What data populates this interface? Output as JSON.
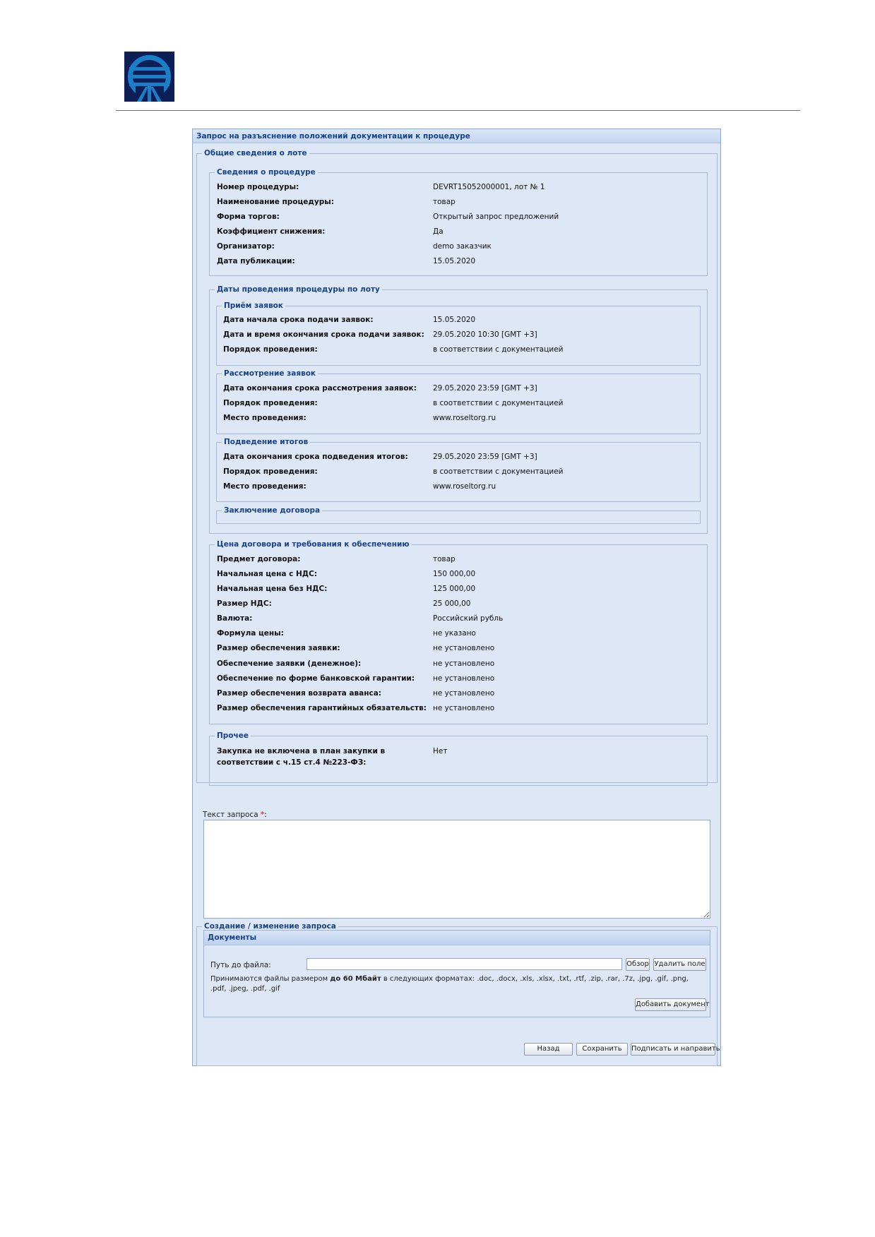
{
  "window": {
    "title": "Запрос на разъяснение положений документации к процедуре"
  },
  "general": {
    "legend": "Общие сведения о лоте",
    "procedure": {
      "legend": "Сведения о процедуре",
      "rows": [
        {
          "label": "Номер процедуры:",
          "value": "DEVRT15052000001, лот № 1"
        },
        {
          "label": "Наименование процедуры:",
          "value": "товар"
        },
        {
          "label": "Форма торгов:",
          "value": "Открытый запрос предложений"
        },
        {
          "label": "Коэффициент снижения:",
          "value": "Да"
        },
        {
          "label": "Организатор:",
          "value": "demo заказчик"
        },
        {
          "label": "Дата публикации:",
          "value": "15.05.2020"
        }
      ]
    },
    "dates": {
      "legend": "Даты проведения процедуры по лоту",
      "receipt": {
        "legend": "Приём заявок",
        "rows": [
          {
            "label": "Дата начала срока подачи заявок:",
            "value": "15.05.2020"
          },
          {
            "label": "Дата и время окончания срока подачи заявок:",
            "value": "29.05.2020 10:30 [GMT +3]"
          },
          {
            "label": "Порядок проведения:",
            "value": "в соответствии с документацией"
          }
        ]
      },
      "review": {
        "legend": "Рассмотрение заявок",
        "rows": [
          {
            "label": "Дата окончания срока рассмотрения заявок:",
            "value": "29.05.2020 23:59 [GMT +3]"
          },
          {
            "label": "Порядок проведения:",
            "value": "в соответствии с документацией"
          },
          {
            "label": "Место проведения:",
            "value": "www.roseltorg.ru"
          }
        ]
      },
      "results": {
        "legend": "Подведение итогов",
        "rows": [
          {
            "label": "Дата окончания срока подведения итогов:",
            "value": "29.05.2020 23:59 [GMT +3]"
          },
          {
            "label": "Порядок проведения:",
            "value": "в соответствии с документацией"
          },
          {
            "label": "Место проведения:",
            "value": "www.roseltorg.ru"
          }
        ]
      },
      "contract": {
        "legend": "Заключение договора"
      }
    },
    "price": {
      "legend": "Цена договора и требования к обеспечению",
      "rows": [
        {
          "label": "Предмет договора:",
          "value": "товар"
        },
        {
          "label": "Начальная цена с НДС:",
          "value": "150 000,00"
        },
        {
          "label": "Начальная цена без НДС:",
          "value": "125 000,00"
        },
        {
          "label": "Размер НДС:",
          "value": "25 000,00"
        },
        {
          "label": "Валюта:",
          "value": "Российский рубль"
        },
        {
          "label": "Формула цены:",
          "value": "не указано"
        },
        {
          "label": "Размер обеспечения заявки:",
          "value": "не установлено"
        },
        {
          "label": "Обеспечение заявки (денежное):",
          "value": "не установлено"
        },
        {
          "label": "Обеспечение по форме банковской гарантии:",
          "value": "не установлено"
        },
        {
          "label": "Размер обеспечения возврата аванса:",
          "value": "не установлено"
        },
        {
          "label": "Размер обеспечения гарантийных обязательств:",
          "value": "не установлено"
        }
      ]
    },
    "other": {
      "legend": "Прочее",
      "rows": [
        {
          "label": "Закупка не включена в план закупки в соответствии с ч.15 ст.4 №223-ФЗ:",
          "value": "Нет"
        }
      ]
    }
  },
  "request": {
    "legend": "Создание / изменение запроса",
    "text_label": "Текст запроса",
    "required_mark": "*",
    "text_label_suffix": ":",
    "text_value": ""
  },
  "documents": {
    "title": "Документы",
    "path_label": "Путь до файла:",
    "path_value": "",
    "browse_button": "Обзор",
    "delete_button": "Удалить поле",
    "hint_prefix": "Принимаются файлы размером ",
    "hint_size": "до 60 Мбайт",
    "hint_suffix": " в следующих форматах: .doc, .docx, .xls, .xlsx, .txt, .rtf, .zip, .rar, .7z, .jpg, .gif, .png, .pdf, .jpeg, .pdf, .gif",
    "add_button": "Добавить документ"
  },
  "footer": {
    "back_button": "Назад",
    "save_button": "Сохранить",
    "sign_button": "Подписать и направить"
  },
  "colors": {
    "logo_bg": "#0d1f56",
    "logo_fg": "#1a7fc6",
    "panel_bg": "#dde7f5",
    "legend_text": "#15428b",
    "required": "#dd0000"
  },
  "icons": {
    "logo": "rosteltorg-logo-icon"
  }
}
